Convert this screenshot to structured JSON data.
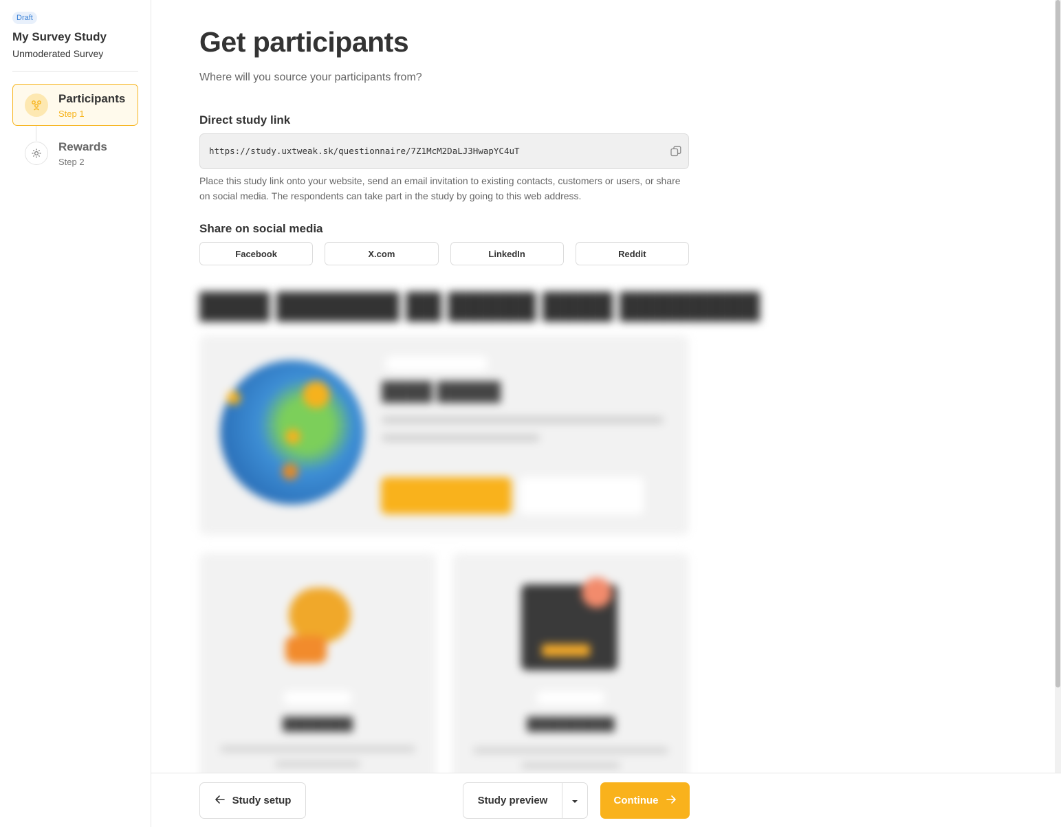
{
  "sidebar": {
    "badge": "Draft",
    "study_title": "My Survey Study",
    "study_type": "Unmoderated Survey",
    "steps": [
      {
        "label": "Participants",
        "sub": "Step 1",
        "icon": "participants-icon",
        "active": true
      },
      {
        "label": "Rewards",
        "sub": "Step 2",
        "icon": "gear-icon",
        "active": false
      }
    ]
  },
  "main": {
    "title": "Get participants",
    "subtitle": "Where will you source your participants from?",
    "direct_link": {
      "heading": "Direct study link",
      "url": "https://study.uxtweak.sk/questionnaire/7Z1McM2DaLJ3HwapYC4uT",
      "help": "Place this study link onto your website, send an email invitation to existing contacts, customers or users, or share on social media. The respondents can take part in the study by going to this web address."
    },
    "social": {
      "heading": "Share on social media",
      "buttons": [
        "Facebook",
        "X.com",
        "LinkedIn",
        "Reddit"
      ]
    }
  },
  "footer": {
    "back_label": "Study setup",
    "preview_label": "Study preview",
    "continue_label": "Continue"
  },
  "colors": {
    "accent": "#f9b21c",
    "draft_badge_bg": "#e8f0fb",
    "draft_badge_text": "#3b82d6"
  }
}
